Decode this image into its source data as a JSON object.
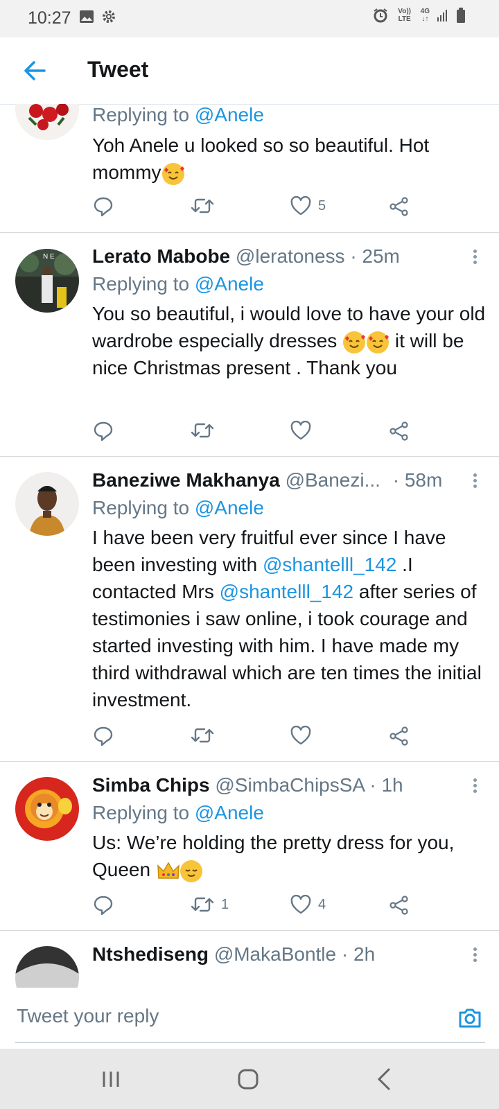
{
  "status": {
    "time": "10:27",
    "volte": "Vo)) LTE",
    "network": "4G"
  },
  "appbar": {
    "title": "Tweet"
  },
  "tweets": [
    {
      "name": "",
      "handle": "",
      "time": "",
      "replying_label": "Replying to",
      "replying_to": "@Anele",
      "text": "Yoh Anele u looked so so beautiful.  Hot mommy",
      "reply_count": "",
      "retweet_count": "",
      "like_count": "5"
    },
    {
      "name": "Lerato Mabobe",
      "handle": "@leratoness",
      "time": "· 25m",
      "replying_label": "Replying to",
      "replying_to": "@Anele",
      "text": "You so beautiful, i would love to have your old wardrobe especially dresses",
      "text_after": " it will be nice Christmas present . Thank you",
      "reply_count": "",
      "retweet_count": "",
      "like_count": ""
    },
    {
      "name": "Baneziwe Makhanya",
      "handle": "@Banezi...",
      "time": "· 58m",
      "replying_label": "Replying to",
      "replying_to": "@Anele",
      "text_parts": [
        "I have been very fruitful ever since I have been investing with ",
        "@shantelll_142",
        " .I contacted Mrs ",
        "@shantelll_142",
        " after series of testimonies i saw online, i took courage and started investing with him. I have made my third withdrawal which are ten times the initial investment."
      ],
      "reply_count": "",
      "retweet_count": "",
      "like_count": ""
    },
    {
      "name": "Simba Chips",
      "handle": "@SimbaChipsSA",
      "time": "· 1h",
      "replying_label": "Replying to",
      "replying_to": "@Anele",
      "text": "Us: We’re holding the pretty dress for you, Queen",
      "reply_count": "",
      "retweet_count": "1",
      "like_count": "4"
    },
    {
      "name": "Ntshediseng",
      "handle": "@MakaBontle",
      "time": "· 2h"
    }
  ],
  "reply": {
    "placeholder": "Tweet your reply"
  },
  "colors": {
    "accent": "#1b95e0",
    "secondary_text": "#657786"
  }
}
